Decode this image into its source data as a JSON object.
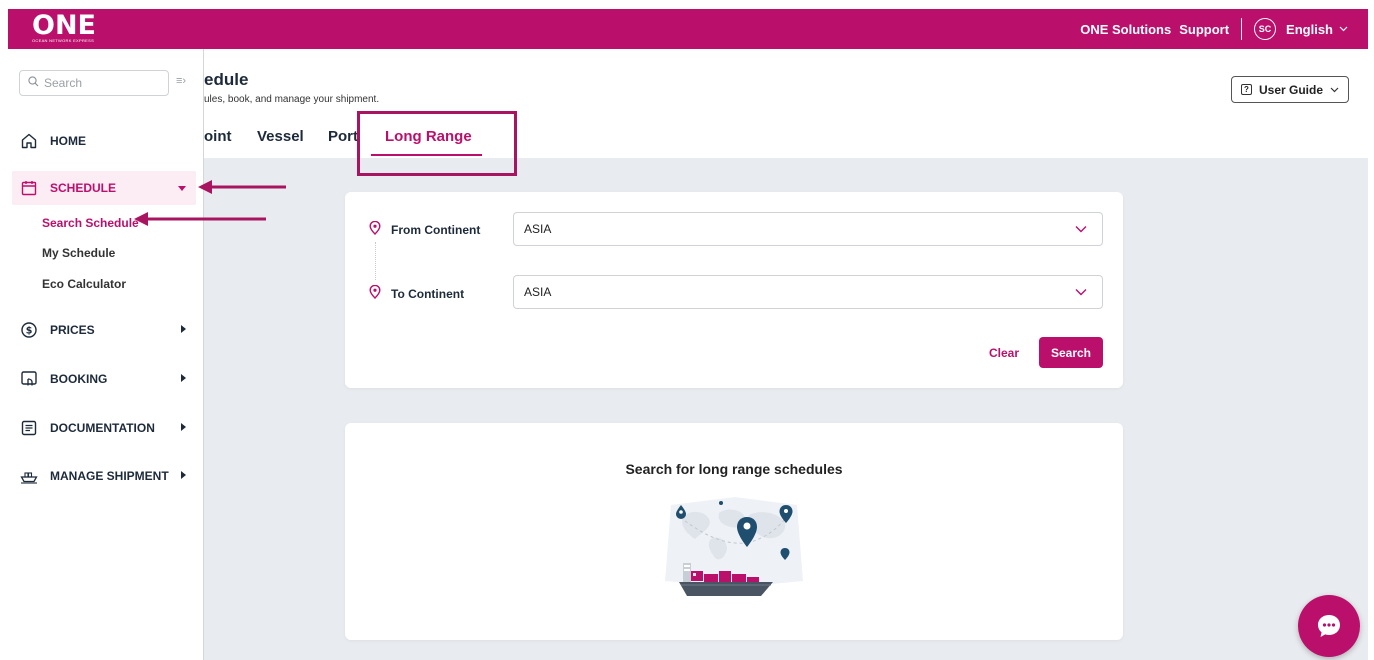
{
  "header": {
    "logo_text": "ONE",
    "logo_tagline": "OCEAN NETWORK EXPRESS",
    "links": [
      "ONE Solutions",
      "Support"
    ],
    "avatar_initials": "SC",
    "language": "English"
  },
  "sidebar": {
    "search_placeholder": "Search",
    "items": [
      {
        "label": "HOME",
        "icon": "home-icon"
      },
      {
        "label": "SCHEDULE",
        "icon": "calendar-icon"
      },
      {
        "label": "PRICES",
        "icon": "dollar-icon"
      },
      {
        "label": "BOOKING",
        "icon": "booking-icon"
      },
      {
        "label": "DOCUMENTATION",
        "icon": "document-icon"
      },
      {
        "label": "MANAGE SHIPMENT",
        "icon": "ship-icon"
      }
    ],
    "schedule_sub": [
      "Search Schedule",
      "My Schedule",
      "Eco Calculator"
    ]
  },
  "page": {
    "title_visible": "edule",
    "subtitle_visible": "ules, book, and manage your shipment.",
    "tabs": [
      "oint",
      "Vessel",
      "Port",
      "Long Range"
    ],
    "active_tab": "Long Range",
    "user_guide": "User Guide"
  },
  "form": {
    "from_label": "From Continent",
    "from_value": "ASIA",
    "to_label": "To Continent",
    "to_value": "ASIA",
    "clear_label": "Clear",
    "search_label": "Search"
  },
  "empty_state": {
    "title": "Search for long range schedules"
  },
  "colors": {
    "brand": "#bb0f6c",
    "annotation": "#a8145f",
    "page_bg": "#e8ebef"
  }
}
